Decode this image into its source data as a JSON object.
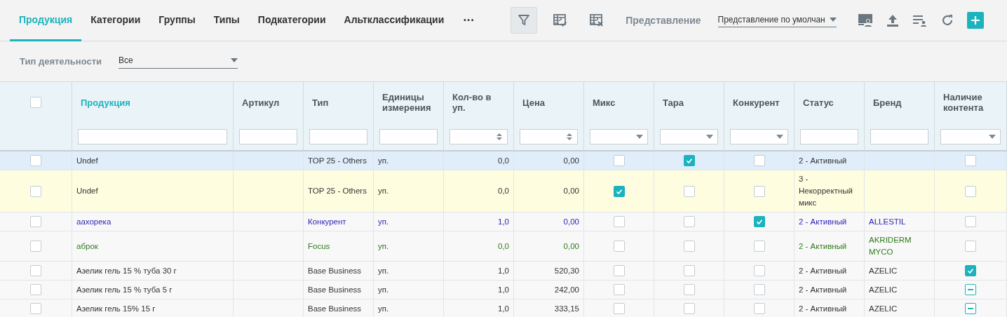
{
  "tabs": [
    {
      "label": "Продукция",
      "selected": true
    },
    {
      "label": "Категории",
      "selected": false
    },
    {
      "label": "Группы",
      "selected": false
    },
    {
      "label": "Типы",
      "selected": false
    },
    {
      "label": "Подкатегории",
      "selected": false
    },
    {
      "label": "Альтклассификации",
      "selected": false
    }
  ],
  "more_tabs": "···",
  "toolbar": {
    "filter_active": true,
    "view_label": "Представление",
    "view_value": "Представление по умолчан"
  },
  "activity_filter": {
    "label": "Тип деятельности",
    "value": "Все"
  },
  "table": {
    "select_all_checked": false,
    "columns": [
      {
        "label": "Продукция",
        "active": true,
        "filter": {
          "kind": "text"
        }
      },
      {
        "label": "Артикул",
        "active": false,
        "filter": {
          "kind": "text"
        }
      },
      {
        "label": "Тип",
        "active": false,
        "filter": {
          "kind": "text"
        }
      },
      {
        "label": "Единицы измерения",
        "active": false,
        "filter": {
          "kind": "text"
        }
      },
      {
        "label": "Кол-во в уп.",
        "active": false,
        "filter": {
          "kind": "number"
        }
      },
      {
        "label": "Цена",
        "active": false,
        "filter": {
          "kind": "number"
        }
      },
      {
        "label": "Микс",
        "active": false,
        "filter": {
          "kind": "select"
        }
      },
      {
        "label": "Тара",
        "active": false,
        "filter": {
          "kind": "select"
        }
      },
      {
        "label": "Конкурент",
        "active": false,
        "filter": {
          "kind": "select"
        }
      },
      {
        "label": "Статус",
        "active": false,
        "filter": {
          "kind": "text"
        }
      },
      {
        "label": "Бренд",
        "active": false,
        "filter": {
          "kind": "text"
        }
      },
      {
        "label": "Наличие контента",
        "active": false,
        "filter": {
          "kind": "select"
        }
      }
    ],
    "rows": [
      {
        "hovered": true,
        "warning": false,
        "kind": "regular",
        "checked": false,
        "product": "Undef",
        "type": "TOP 25 - Others",
        "unit": "уп.",
        "qty": "0,0",
        "price": "0,00",
        "mix": false,
        "tara": true,
        "competitor": false,
        "status": "2 - Активный",
        "content": {
          "checked": false
        }
      },
      {
        "hovered": false,
        "warning": true,
        "kind": "regular",
        "checked": false,
        "product": "Undef",
        "type": "TOP 25 - Others",
        "unit": "уп.",
        "qty": "0,0",
        "price": "0,00",
        "mix": true,
        "tara": false,
        "competitor": false,
        "status": "3 - Некорректный микс",
        "content": {
          "checked": false
        }
      },
      {
        "hovered": false,
        "warning": false,
        "kind": "competitor",
        "checked": false,
        "product": "аахорека",
        "type": "Конкурент",
        "unit": "уп.",
        "qty": "1,0",
        "price": "0,00",
        "mix": false,
        "tara": false,
        "competitor": true,
        "status": "2 - Активный",
        "brand": "ALLESTIL",
        "content": {
          "checked": false
        }
      },
      {
        "hovered": false,
        "warning": false,
        "kind": "focus",
        "checked": false,
        "product": "аброк",
        "type": "Focus",
        "unit": "уп.",
        "qty": "0,0",
        "price": "0,00",
        "mix": false,
        "tara": false,
        "competitor": false,
        "status": "2 - Активный",
        "brand": "AKRIDERM MYCO",
        "content": {
          "checked": false
        }
      },
      {
        "hovered": false,
        "warning": false,
        "kind": "regular",
        "checked": false,
        "product": "Азелик гель 15 % туба 30 г",
        "type": "Base Business",
        "unit": "уп.",
        "qty": "1,0",
        "price": "520,30",
        "mix": false,
        "tara": false,
        "competitor": false,
        "status": "2 - Активный",
        "brand": "AZELIC",
        "content": {
          "checked": true,
          "kind": "tick"
        }
      },
      {
        "hovered": false,
        "warning": false,
        "kind": "regular",
        "checked": false,
        "product": "Азелик гель 15 % туба 5 г",
        "type": "Base Business",
        "unit": "уп.",
        "qty": "1,0",
        "price": "242,00",
        "mix": false,
        "tara": false,
        "competitor": false,
        "status": "2 - Активный",
        "brand": "AZELIC",
        "content": {
          "checked": true,
          "kind": "dash"
        }
      },
      {
        "hovered": false,
        "warning": false,
        "kind": "regular",
        "checked": false,
        "product": "Азелик гель 15% 15 г",
        "type": "Base Business",
        "unit": "уп.",
        "qty": "1,0",
        "price": "333,15",
        "mix": false,
        "tara": false,
        "competitor": false,
        "status": "2 - Активный",
        "brand": "AZELIC",
        "content": {
          "checked": true,
          "kind": "dash"
        }
      }
    ]
  }
}
